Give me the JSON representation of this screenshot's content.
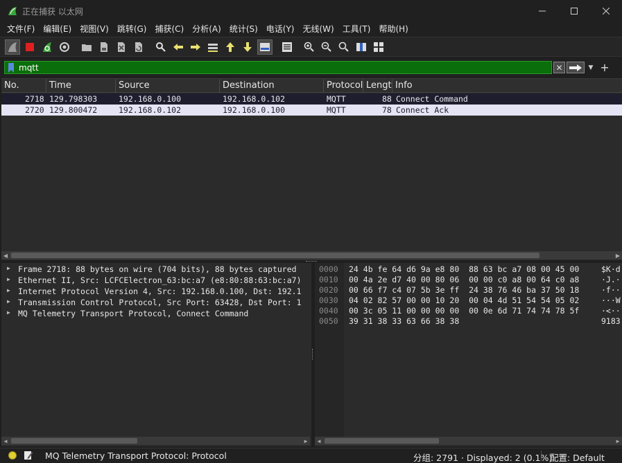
{
  "window": {
    "title": "正在捕获 以太网",
    "minimize_icon": "minimize-icon",
    "maximize_icon": "maximize-icon",
    "close_icon": "close-icon"
  },
  "menu": [
    {
      "label": "文件(F)"
    },
    {
      "label": "编辑(E)"
    },
    {
      "label": "视图(V)"
    },
    {
      "label": "跳转(G)"
    },
    {
      "label": "捕获(C)"
    },
    {
      "label": "分析(A)"
    },
    {
      "label": "统计(S)"
    },
    {
      "label": "电话(Y)"
    },
    {
      "label": "无线(W)"
    },
    {
      "label": "工具(T)"
    },
    {
      "label": "帮助(H)"
    }
  ],
  "toolbar": {
    "icons": [
      "start-capture-icon",
      "stop-capture-icon",
      "restart-capture-icon",
      "capture-options-icon",
      "open-file-icon",
      "save-file-icon",
      "close-file-icon",
      "reload-file-icon",
      "find-packet-icon",
      "go-back-icon",
      "go-forward-icon",
      "go-to-packet-icon",
      "first-packet-icon",
      "last-packet-icon",
      "auto-scroll-icon",
      "colorize-icon",
      "zoom-in-icon",
      "zoom-out-icon",
      "normal-size-icon",
      "resize-columns-icon",
      "layout-icon"
    ]
  },
  "filter": {
    "value": "mqtt",
    "background": "#0a6e0a"
  },
  "packet_list": {
    "columns": [
      "No.",
      "Time",
      "Source",
      "Destination",
      "Protocol",
      "Lengtł",
      "Info"
    ],
    "rows": [
      {
        "no": "2718",
        "time": "129.798303",
        "source": "192.168.0.100",
        "destination": "192.168.0.102",
        "protocol": "MQTT",
        "length": "88",
        "info": "Connect Command"
      },
      {
        "no": "2720",
        "time": "129.800472",
        "source": "192.168.0.102",
        "destination": "192.168.0.100",
        "protocol": "MQTT",
        "length": "78",
        "info": "Connect Ack"
      }
    ]
  },
  "details": [
    "Frame 2718: 88 bytes on wire (704 bits), 88 bytes captured",
    "Ethernet II, Src: LCFCElectron_63:bc:a7 (e8:80:88:63:bc:a7)",
    "Internet Protocol Version 4, Src: 192.168.0.100, Dst: 192.1",
    "Transmission Control Protocol, Src Port: 63428, Dst Port: 1",
    "MQ Telemetry Transport Protocol, Connect Command"
  ],
  "bytes": [
    {
      "offset": "0000",
      "hex": "24 4b fe 64 d6 9a e8 80  88 63 bc a7 08 00 45 00",
      "ascii": "$K·d"
    },
    {
      "offset": "0010",
      "hex": "00 4a 2e d7 40 00 80 06  00 00 c0 a8 00 64 c0 a8",
      "ascii": "·J.·"
    },
    {
      "offset": "0020",
      "hex": "00 66 f7 c4 07 5b 3e ff  24 38 76 46 ba 37 50 18",
      "ascii": "·f··"
    },
    {
      "offset": "0030",
      "hex": "04 02 82 57 00 00 10 20  00 04 4d 51 54 54 05 02",
      "ascii": "···W"
    },
    {
      "offset": "0040",
      "hex": "00 3c 05 11 00 00 00 00  00 0e 6d 71 74 74 78 5f",
      "ascii": "·<··"
    },
    {
      "offset": "0050",
      "hex": "39 31 38 33 63 66 38 38",
      "ascii": "9183"
    }
  ],
  "status": {
    "text": "MQ Telemetry Transport Protocol: Protocol",
    "counts": "分组: 2791 · Displayed: 2 (0.1%)",
    "profile": "配置: Default",
    "led_color": "#e0d030"
  }
}
